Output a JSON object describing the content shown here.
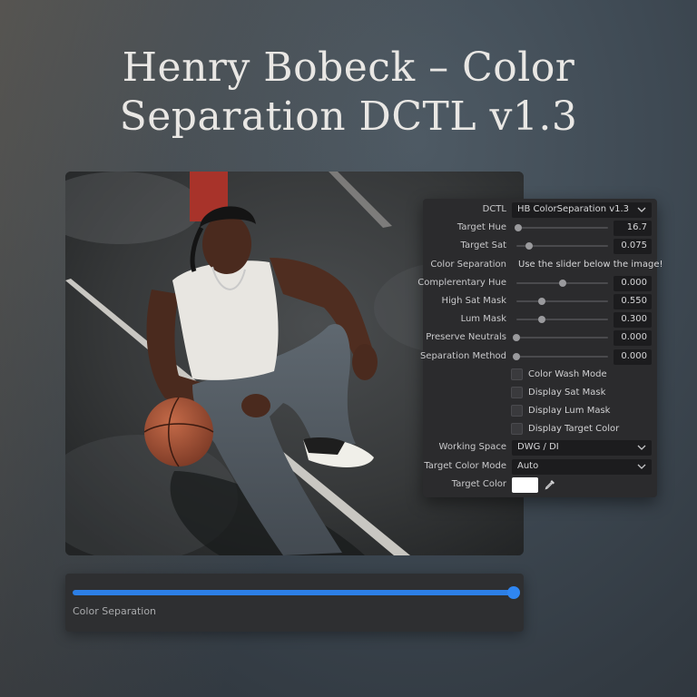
{
  "title": {
    "line1": "Henry Bobeck – Color",
    "line2": "Separation DCTL v1.3"
  },
  "colors": {
    "accent_blue": "#2c7fe6",
    "panel_bg": "#2b2b2d",
    "field_bg": "#1c1c1e",
    "target_color": "#ffffff"
  },
  "photo": {
    "icon": "photo-basketball-player-icon"
  },
  "panel": {
    "dctl": {
      "label": "DCTL",
      "value": "HB ColorSeparation v1.3"
    },
    "target_hue": {
      "label": "Target Hue",
      "value": "16.7",
      "position": 0.02
    },
    "target_sat": {
      "label": "Target Sat",
      "value": "0.075",
      "position": 0.14
    },
    "color_separation": {
      "label": "Color Separation",
      "message": "Use the slider below the image!"
    },
    "complementary_hue": {
      "label": "Complerentary Hue",
      "value": "0.000",
      "position": 0.5
    },
    "high_sat_mask": {
      "label": "High Sat Mask",
      "value": "0.550",
      "position": 0.28
    },
    "lum_mask": {
      "label": "Lum Mask",
      "value": "0.300",
      "position": 0.28
    },
    "preserve_neutrals": {
      "label": "Preserve Neutrals",
      "value": "0.000",
      "position": 0.0
    },
    "separation_method": {
      "label": "Separation Method",
      "value": "0.000",
      "position": 0.0
    },
    "checkboxes": [
      {
        "label": "Color Wash Mode",
        "checked": false
      },
      {
        "label": "Display Sat Mask",
        "checked": false
      },
      {
        "label": "Display Lum Mask",
        "checked": false
      },
      {
        "label": "Display Target Color",
        "checked": false
      }
    ],
    "working_space": {
      "label": "Working Space",
      "value": "DWG / DI"
    },
    "target_color_mode": {
      "label": "Target Color Mode",
      "value": "Auto"
    },
    "target_color": {
      "label": "Target Color",
      "icon": "eyedropper-icon"
    }
  },
  "color_separation_slider": {
    "label": "Color Separation",
    "position": 1.0
  }
}
